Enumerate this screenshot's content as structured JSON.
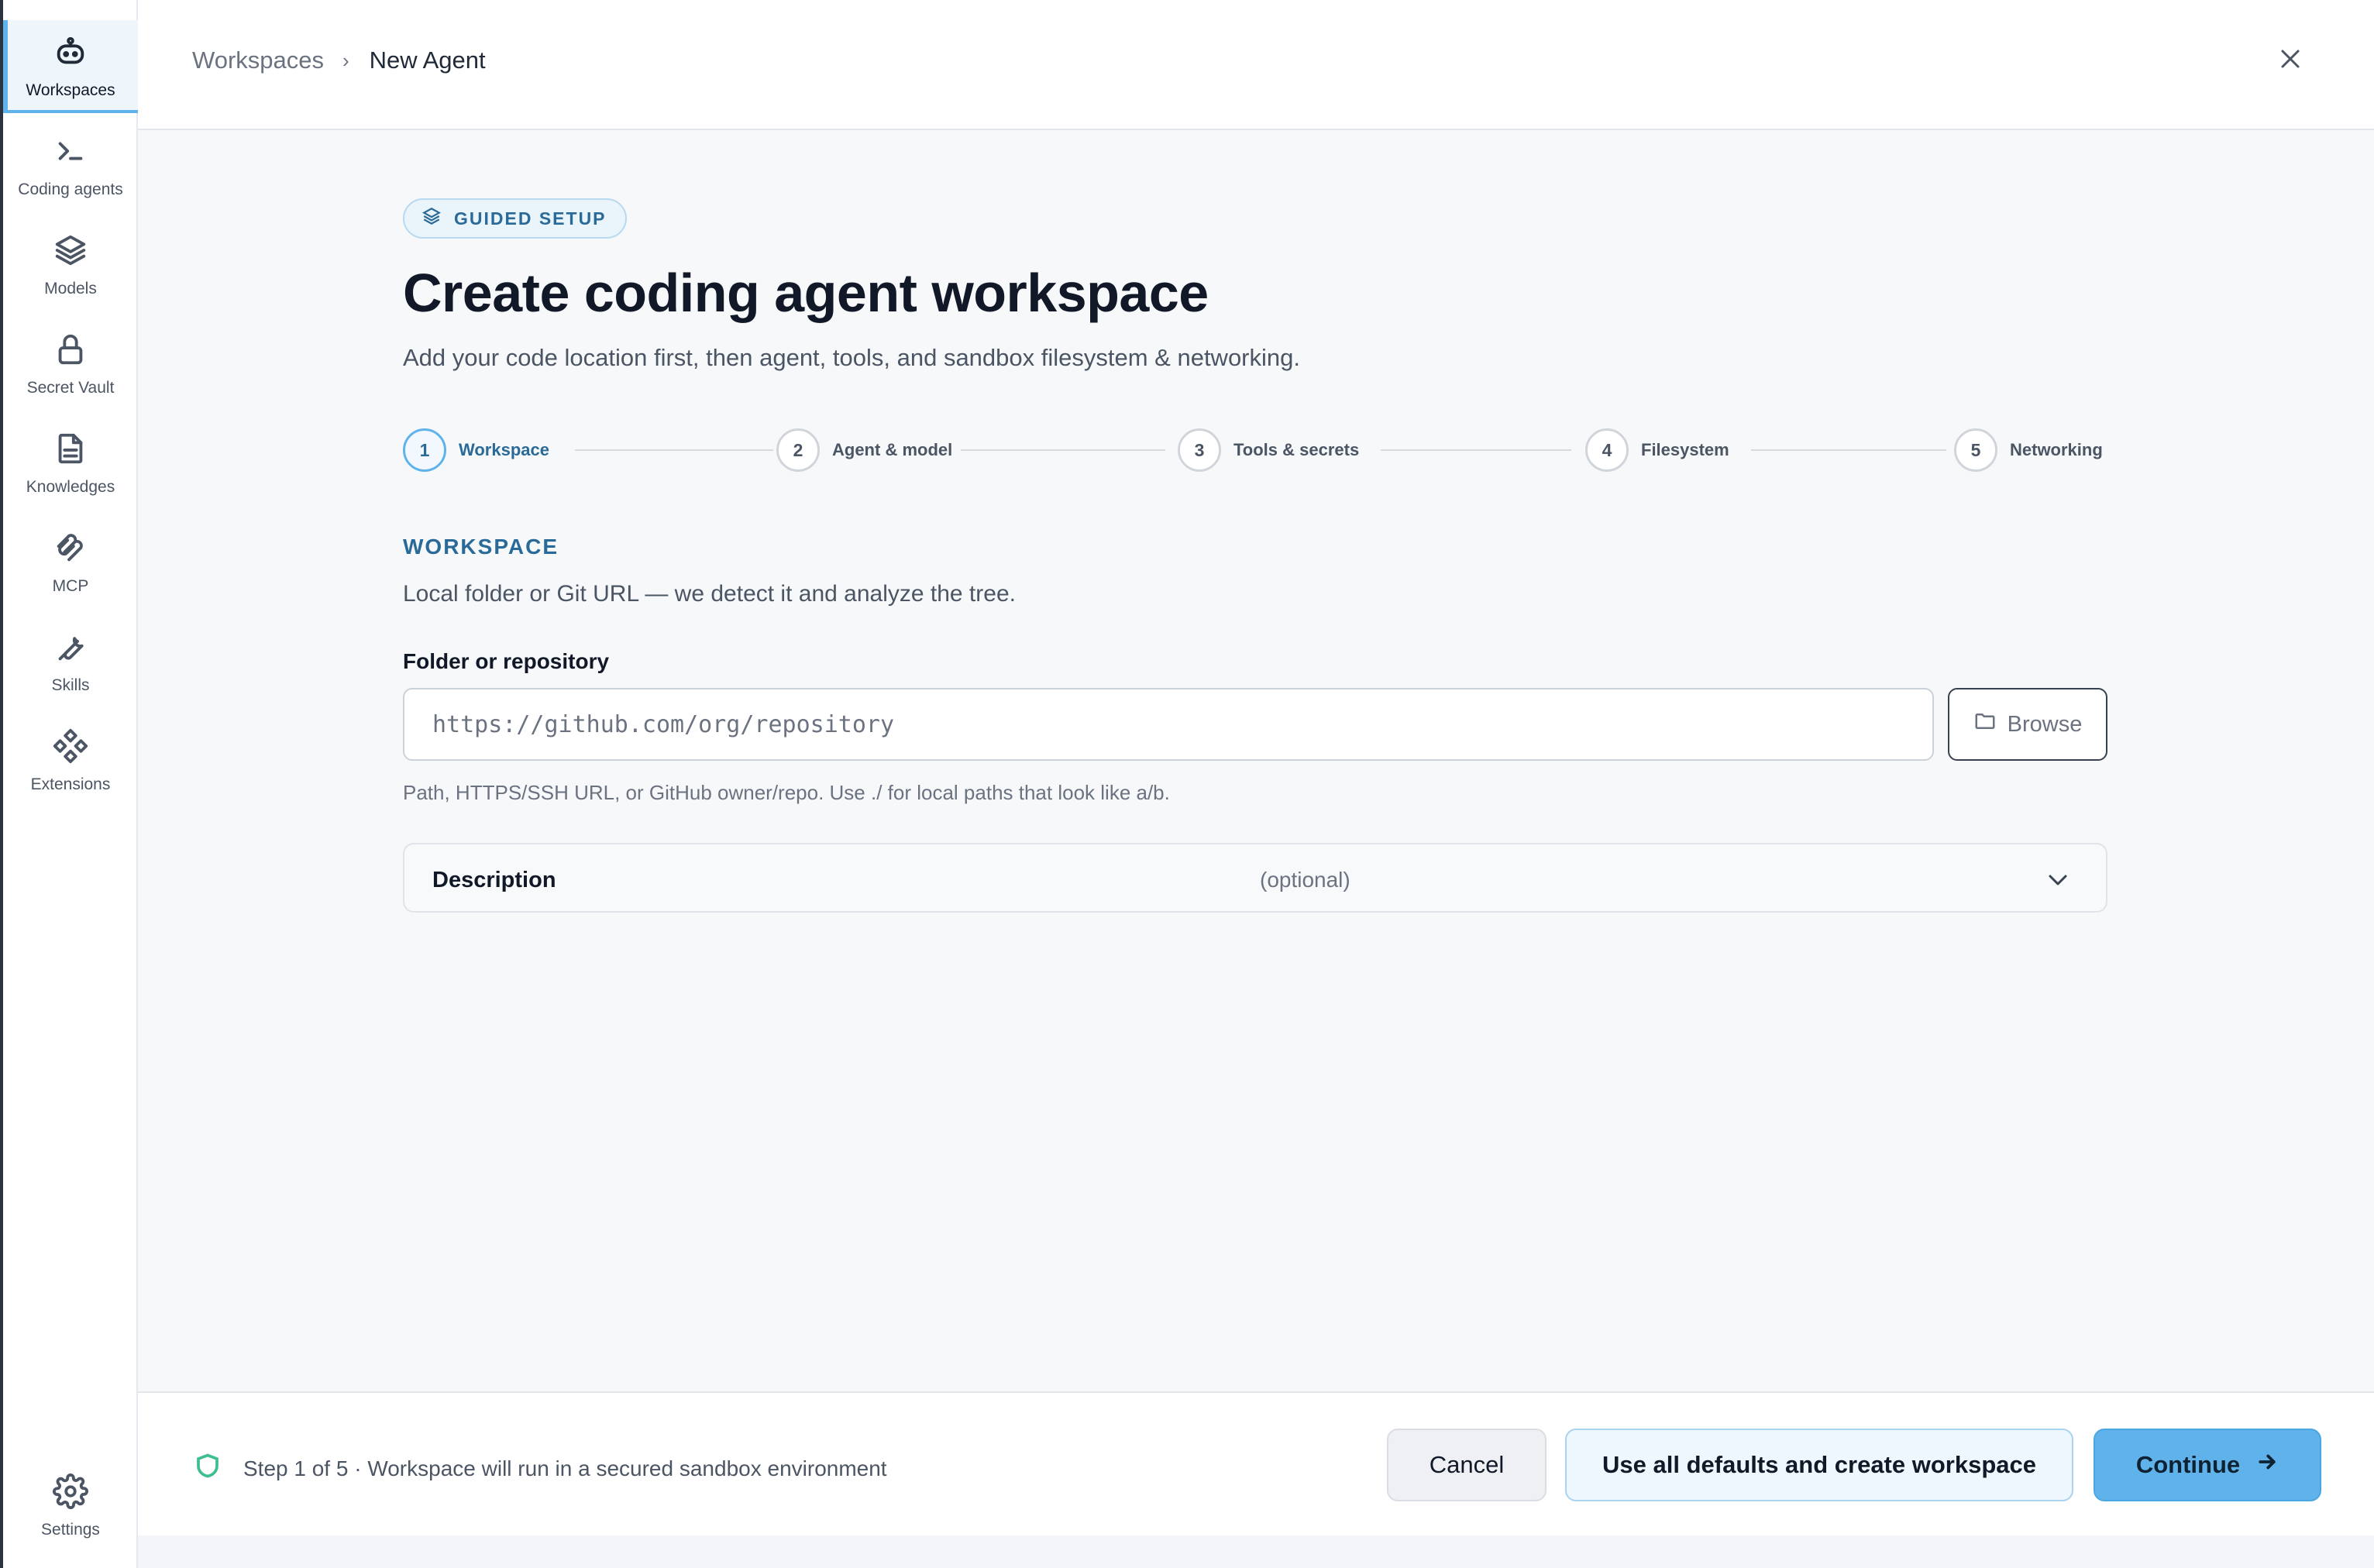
{
  "sidebar": {
    "items": [
      {
        "label": "Workspaces",
        "icon": "robot-icon",
        "active": true
      },
      {
        "label": "Coding agents",
        "icon": "terminal-icon"
      },
      {
        "label": "Models",
        "icon": "layers-icon"
      },
      {
        "label": "Secret Vault",
        "icon": "lock-icon"
      },
      {
        "label": "Knowledges",
        "icon": "document-icon"
      },
      {
        "label": "MCP",
        "icon": "mcp-icon"
      },
      {
        "label": "Skills",
        "icon": "wrench-icon"
      },
      {
        "label": "Extensions",
        "icon": "extensions-icon"
      }
    ],
    "settings": {
      "label": "Settings",
      "icon": "gear-icon"
    }
  },
  "header": {
    "breadcrumb_root": "Workspaces",
    "breadcrumb_current": "New Agent"
  },
  "main": {
    "badge": "GUIDED SETUP",
    "title": "Create coding agent workspace",
    "subtitle": "Add your code location first, then agent, tools, and sandbox filesystem & networking.",
    "steps": [
      {
        "number": "1",
        "label": "Workspace",
        "active": true
      },
      {
        "number": "2",
        "label": "Agent & model"
      },
      {
        "number": "3",
        "label": "Tools & secrets"
      },
      {
        "number": "4",
        "label": "Filesystem"
      },
      {
        "number": "5",
        "label": "Networking"
      }
    ],
    "section_title": "WORKSPACE",
    "section_desc": "Local folder or Git URL — we detect it and analyze the tree.",
    "field_label": "Folder or repository",
    "repo_input": {
      "value": "",
      "placeholder": "https://github.com/org/repository"
    },
    "browse_label": "Browse",
    "help_text": "Path, HTTPS/SSH URL, or GitHub owner/repo. Use ./ for local paths that look like a/b.",
    "description_label": "Description",
    "description_optional": "(optional)"
  },
  "footer": {
    "status": "Step 1 of 5 · Workspace will run in a secured sandbox environment",
    "cancel_label": "Cancel",
    "defaults_label": "Use all defaults and create workspace",
    "continue_label": "Continue"
  },
  "colors": {
    "accent": "#60b3ea",
    "accent_text": "#2a6a98",
    "secure_green": "#3fbf8f"
  }
}
